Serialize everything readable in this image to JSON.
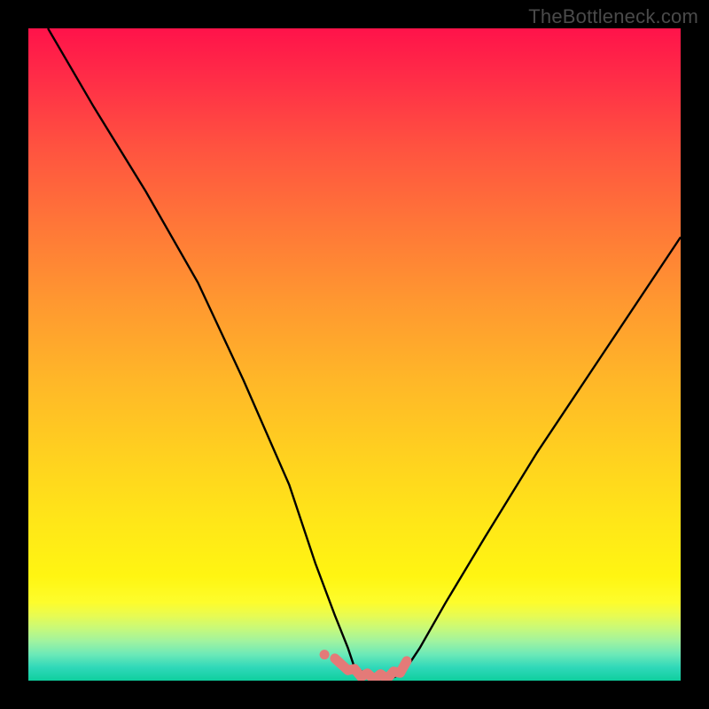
{
  "watermark": "TheBottleneck.com",
  "colors": {
    "frame": "#000000",
    "curve": "#000000",
    "markers": "#e47a78",
    "gradient_top": "#ff134a",
    "gradient_bottom": "#0fcf9e"
  },
  "chart_data": {
    "type": "line",
    "title": "",
    "xlabel": "",
    "ylabel": "",
    "xlim": [
      0,
      100
    ],
    "ylim": [
      0,
      100
    ],
    "series": [
      {
        "name": "bottleneck-curve",
        "x": [
          3,
          10,
          18,
          26,
          33,
          40,
          44,
          47,
          49,
          50,
          52,
          54,
          56,
          57,
          58,
          60,
          64,
          70,
          78,
          88,
          100
        ],
        "values": [
          100,
          88,
          75,
          61,
          46,
          30,
          18,
          10,
          5,
          2,
          1,
          0.5,
          0.5,
          1,
          2,
          5,
          12,
          22,
          35,
          50,
          68
        ]
      }
    ],
    "markers": {
      "name": "lower-section-highlight",
      "x": [
        47,
        49,
        50,
        51,
        52,
        53,
        54,
        55,
        56,
        57,
        58
      ],
      "values": [
        3.0,
        2.0,
        1.4,
        1.0,
        0.7,
        0.6,
        0.6,
        0.7,
        1.0,
        1.6,
        2.6
      ]
    }
  }
}
